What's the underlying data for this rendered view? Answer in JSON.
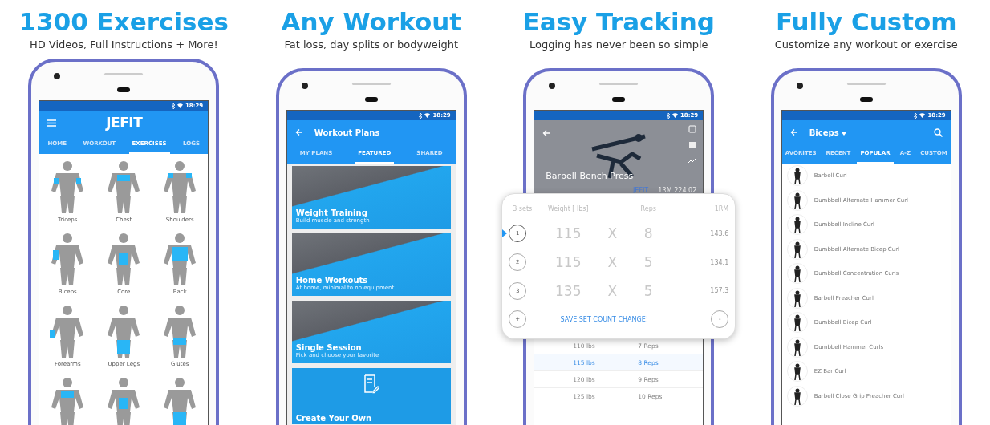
{
  "panels": [
    {
      "kind": "exercises",
      "headline": "1300 Exercises",
      "subtitle": "HD Videos, Full Instructions + More!",
      "phone": {
        "time": "18:29",
        "title": "JEFIT",
        "tabs": [
          {
            "label": "HOME",
            "selected": false
          },
          {
            "label": "WORKOUT",
            "selected": false
          },
          {
            "label": "EXERCISES",
            "selected": true
          },
          {
            "label": "LOGS",
            "selected": false
          }
        ],
        "muscles": [
          {
            "label": "Triceps"
          },
          {
            "label": "Chest"
          },
          {
            "label": "Shoulders"
          },
          {
            "label": "Biceps"
          },
          {
            "label": "Core"
          },
          {
            "label": "Back"
          },
          {
            "label": "Forearms"
          },
          {
            "label": "Upper Legs"
          },
          {
            "label": "Glutes"
          }
        ]
      }
    },
    {
      "kind": "plans",
      "headline": "Any Workout",
      "subtitle": "Fat loss, day splits or bodyweight",
      "phone": {
        "time": "18:29",
        "title": "Workout Plans",
        "tabs": [
          {
            "label": "MY PLANS",
            "selected": false
          },
          {
            "label": "FEATURED",
            "selected": true
          },
          {
            "label": "SHARED",
            "selected": false
          }
        ],
        "cards": [
          {
            "title": "Weight Training",
            "caption": "Build muscle and strength"
          },
          {
            "title": "Home Workouts",
            "caption": "At home, minimal to no equipment"
          },
          {
            "title": "Single Session",
            "caption": "Pick and choose your favorite"
          }
        ],
        "create_label": "Create Your Own"
      }
    },
    {
      "kind": "tracking",
      "headline": "Easy Tracking",
      "subtitle": "Logging has never been so simple",
      "phone": {
        "time": "18:29",
        "exercise": "Barbell Bench Press",
        "brand": "JEFIT",
        "record": "1RM 224.02",
        "columns": [
          "3 sets",
          "Weight [ lbs]",
          "Reps",
          "1RM"
        ],
        "sets": [
          {
            "number": "1",
            "weight": "115",
            "times": "X",
            "reps": "8",
            "one_rm": "143.6",
            "selected": true
          },
          {
            "number": "2",
            "weight": "115",
            "times": "X",
            "reps": "5",
            "one_rm": "134.1",
            "selected": false
          },
          {
            "number": "3",
            "weight": "135",
            "times": "X",
            "reps": "5",
            "one_rm": "157.3",
            "selected": false
          }
        ],
        "add": "+",
        "save": "SAVE SET COUNT CHANGE!",
        "remove": "-",
        "picker": [
          {
            "weight": "110 lbs",
            "reps": "7 Reps",
            "selected": false
          },
          {
            "weight": "115 lbs",
            "reps": "8 Reps",
            "selected": true
          },
          {
            "weight": "120 lbs",
            "reps": "9 Reps",
            "selected": false
          },
          {
            "weight": "125 lbs",
            "reps": "10 Reps",
            "selected": false
          }
        ]
      }
    },
    {
      "kind": "custom",
      "headline": "Fully Custom",
      "subtitle": "Customize any workout or exercise",
      "phone": {
        "time": "18:29",
        "title": "Biceps",
        "tabs": [
          {
            "label": "AVORITES",
            "selected": false
          },
          {
            "label": "RECENT",
            "selected": false
          },
          {
            "label": "POPULAR",
            "selected": true
          },
          {
            "label": "A-Z",
            "selected": false
          },
          {
            "label": "CUSTOM",
            "selected": false
          }
        ],
        "exercises": [
          "Barbell Curl",
          "Dumbbell Alternate Hammer Curl",
          "Dumbbell Incline Curl",
          "Dumbbell Alternate Bicep Curl",
          "Dumbbell Concentration Curls",
          "Barbell Preacher Curl",
          "Dumbbell Bicep Curl",
          "Dumbbell Hammer Curls",
          "EZ Bar Curl",
          "Barbell Close Grip Preacher Curl"
        ]
      }
    }
  ]
}
